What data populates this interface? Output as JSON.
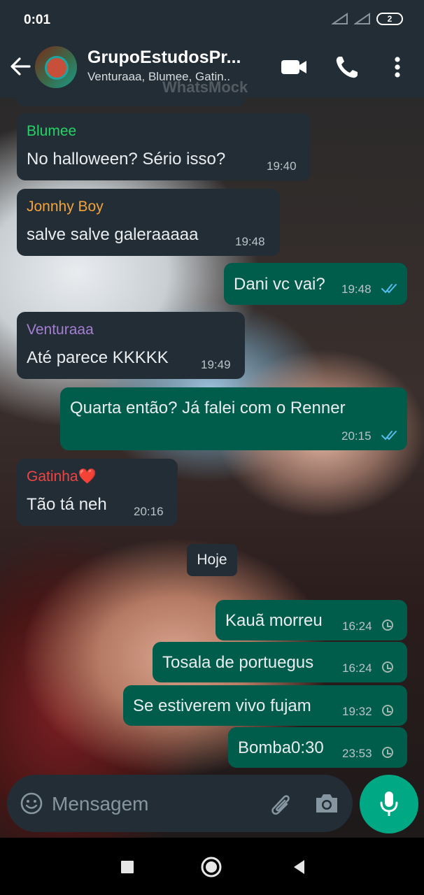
{
  "status_bar": {
    "time": "0:01",
    "battery": "2"
  },
  "header": {
    "title": "GrupoEstudosPr...",
    "subtitle": "Venturaaa, Blumee, Gatin..",
    "watermark": "WhatsMock"
  },
  "messages": [
    {
      "direction": "in",
      "sender": "Blumee",
      "sender_color": "#25d366",
      "text": "No halloween? Sério isso?",
      "time": "19:40"
    },
    {
      "direction": "in",
      "sender": "Jonnhy Boy",
      "sender_color": "#f2a43a",
      "text": "salve salve galeraaaaa",
      "time": "19:48"
    },
    {
      "direction": "out",
      "text": "Dani vc vai?",
      "time": "19:48",
      "status": "read"
    },
    {
      "direction": "in",
      "sender": "Venturaaa",
      "sender_color": "#a57fd3",
      "text": "Até parece KKKKK",
      "time": "19:49"
    },
    {
      "direction": "out",
      "text": "Quarta então? Já falei com o Renner",
      "time": "20:15",
      "status": "read"
    },
    {
      "direction": "in",
      "sender": "Gatinha❤️",
      "sender_color": "#ef4444",
      "text": "Tão tá neh",
      "time": "20:16"
    },
    {
      "direction": "out",
      "text": "Kauã morreu",
      "time": "16:24",
      "status": "pending"
    },
    {
      "direction": "out",
      "text": "Tosala de portuegus",
      "time": "16:24",
      "status": "pending"
    },
    {
      "direction": "out",
      "text": "Se estiverem vivo fujam",
      "time": "19:32",
      "status": "pending"
    },
    {
      "direction": "out",
      "text": "Bomba0:30",
      "time": "23:53",
      "status": "pending"
    }
  ],
  "day_separator": "Hoje",
  "input": {
    "placeholder": "Mensagem"
  },
  "colors": {
    "header_bg": "#232d36",
    "incoming_bubble": "#232d36",
    "outgoing_bubble": "#005c4b",
    "accent": "#00a884",
    "read_tick": "#53bdeb"
  }
}
